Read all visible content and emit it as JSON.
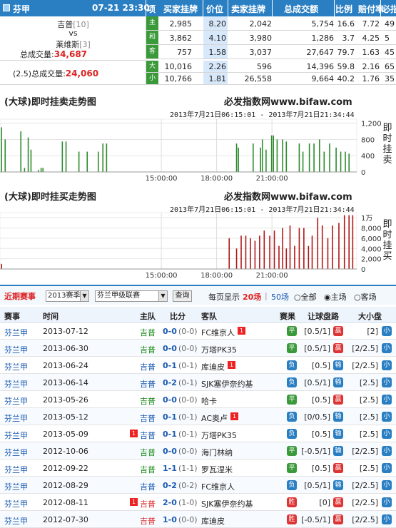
{
  "header": {
    "league": "芬甲",
    "datetime": "07-21 23:30",
    "cols": [
      "项",
      "买家挂牌",
      "价位",
      "卖家挂牌",
      "总成交额",
      "比例",
      "赔付率",
      "必指"
    ]
  },
  "match": {
    "home": "吉普",
    "home_rank": "[10]",
    "vs": "vs",
    "away": "莱维斯",
    "away_rank": "[3]",
    "total_label": "总成交量:",
    "total": "34,687",
    "ou_label": "(2.5)总成交量:",
    "ou_total": "24,060"
  },
  "market_rows": [
    {
      "label": "主",
      "buy": "2,985",
      "price": "8.20",
      "sell": "2,042",
      "total": "5,754",
      "ratio": "16.6",
      "payout": "7.72",
      "idx": "49"
    },
    {
      "label": "和",
      "buy": "3,862",
      "price": "4.10",
      "sell": "3,980",
      "total": "1,286",
      "ratio": "3.7",
      "payout": "4.25",
      "idx": "5"
    },
    {
      "label": "客",
      "buy": "757",
      "price": "1.58",
      "sell": "3,037",
      "total": "27,647",
      "ratio": "79.7",
      "payout": "1.63",
      "idx": "45"
    },
    {
      "label": "大",
      "buy": "10,016",
      "price": "2.26",
      "sell": "596",
      "total": "14,396",
      "ratio": "59.8",
      "payout": "2.16",
      "idx": "65"
    },
    {
      "label": "小",
      "buy": "10,766",
      "price": "1.81",
      "sell": "26,558",
      "total": "9,664",
      "ratio": "40.2",
      "payout": "1.76",
      "idx": "35"
    }
  ],
  "chart1": {
    "title": "(大球)即时挂卖走势图",
    "site": "必发指数网www.bifaw.com",
    "range": "2013年7月21日06:15:01 - 2013年7月21日21:34:44",
    "side_label": "即时挂卖",
    "yticks": [
      "1,200",
      "800",
      "400",
      "0"
    ],
    "xticks": [
      "15:00:00",
      "18:00:00",
      "21:00:00"
    ]
  },
  "chart2": {
    "title": "(大球)即时挂买走势图",
    "site": "必发指数网www.bifaw.com",
    "range": "2013年7月21日06:15:01 - 2013年7月21日21:34:44",
    "side_label": "即时挂买",
    "yticks": [
      "1万",
      "8,000",
      "6,000",
      "4,000",
      "2,000",
      "0"
    ],
    "xticks": [
      "15:00:00",
      "18:00:00",
      "21:00:00"
    ]
  },
  "chart_data": [
    {
      "type": "bar",
      "title": "(大球)即时挂卖走势图",
      "ylim": [
        0,
        1300
      ],
      "x_range": [
        "06:15:01",
        "21:34:44"
      ],
      "values": [
        [
          6.3,
          1100
        ],
        [
          6.5,
          800
        ],
        [
          7.35,
          1000
        ],
        [
          7.55,
          100
        ],
        [
          7.75,
          850
        ],
        [
          7.9,
          550
        ],
        [
          8.3,
          50
        ],
        [
          8.45,
          100
        ],
        [
          8.55,
          100
        ],
        [
          9.6,
          750
        ],
        [
          9.8,
          750
        ],
        [
          10.5,
          500
        ],
        [
          10.95,
          500
        ],
        [
          11.55,
          500
        ],
        [
          11.8,
          700
        ],
        [
          12.0,
          700
        ],
        [
          19.05,
          700
        ],
        [
          19.15,
          600
        ],
        [
          19.95,
          700
        ],
        [
          20.35,
          600
        ],
        [
          20.45,
          800
        ],
        [
          20.65,
          550
        ],
        [
          20.95,
          900
        ],
        [
          21.05,
          900
        ],
        [
          21.25,
          800
        ],
        [
          21.55,
          800
        ],
        [
          21.75,
          750
        ],
        [
          22.45,
          700
        ],
        [
          22.65,
          500
        ],
        [
          23.0,
          700
        ],
        [
          23.25,
          700
        ],
        [
          23.55,
          800
        ],
        [
          23.8,
          500
        ],
        [
          24.1,
          700
        ],
        [
          24.45,
          600
        ],
        [
          24.7,
          500
        ],
        [
          24.95,
          500
        ],
        [
          25.15,
          450
        ]
      ]
    },
    {
      "type": "bar",
      "title": "(大球)即时挂买走势图",
      "ylim": [
        0,
        11000
      ],
      "x_range": [
        "06:15:01",
        "21:34:44"
      ],
      "values": [
        [
          6.3,
          1000
        ],
        [
          18.65,
          6000
        ],
        [
          19.05,
          4000
        ],
        [
          19.3,
          6500
        ],
        [
          19.55,
          6500
        ],
        [
          19.8,
          6000
        ],
        [
          20.05,
          5500
        ],
        [
          20.3,
          6500
        ],
        [
          20.55,
          7500
        ],
        [
          20.85,
          6500
        ],
        [
          21.1,
          7500
        ],
        [
          21.35,
          4500
        ],
        [
          21.55,
          8000
        ],
        [
          21.75,
          4000
        ],
        [
          21.95,
          8500
        ],
        [
          22.2,
          4500
        ],
        [
          22.45,
          8000
        ],
        [
          22.7,
          8000
        ],
        [
          22.95,
          4500
        ],
        [
          23.15,
          6500
        ],
        [
          23.45,
          10000
        ],
        [
          23.7,
          8500
        ],
        [
          24.0,
          6000
        ],
        [
          24.25,
          8500
        ],
        [
          24.6,
          9000
        ],
        [
          24.9,
          10500
        ],
        [
          25.15,
          10500
        ],
        [
          25.35,
          10500
        ]
      ]
    }
  ],
  "filter": {
    "label": "近期赛事",
    "season": "2013赛季",
    "league": "芬兰甲级联赛",
    "query": "查询",
    "per_page_label": "每页显示",
    "per_page": "20场",
    "opt_50": "50场",
    "opt_all": "全部",
    "opt_home": "主场",
    "opt_away": "客场"
  },
  "table_headers": [
    "赛事",
    "时间",
    "主队",
    "比分",
    "客队",
    "赛果",
    "让球盘路",
    "大小盘"
  ],
  "matches": [
    {
      "league": "芬兰甲",
      "date": "2013-07-12",
      "home": "吉普",
      "score": "0-0",
      "ht": "(0-0)",
      "away": "FC维京人",
      "away_card": "1",
      "result": "平",
      "result_color": "#3a9a3a",
      "hcp": "[0.5/1]",
      "hcp_res": "赢",
      "hcp_color": "#d33",
      "ou": "[2]",
      "ou_res": "小",
      "ou_color": "#2a7fc3",
      "home_color": "#1a8a1a"
    },
    {
      "league": "芬兰甲",
      "date": "2013-06-30",
      "home": "吉普",
      "score": "0-0",
      "ht": "(0-0)",
      "away": "万塔PK35",
      "result": "平",
      "result_color": "#3a9a3a",
      "hcp": "[0.5/1]",
      "hcp_res": "赢",
      "hcp_color": "#d33",
      "ou": "[2/2.5]",
      "ou_res": "小",
      "ou_color": "#2a7fc3",
      "home_color": "#1a8a1a"
    },
    {
      "league": "芬兰甲",
      "date": "2013-06-24",
      "home": "吉普",
      "score": "0-1",
      "ht": "(0-1)",
      "away": "库迪皮",
      "away_card": "1",
      "result": "负",
      "result_color": "#2a7fc3",
      "hcp": "[0.5]",
      "hcp_res": "输",
      "hcp_color": "#2a7fc3",
      "ou": "[2/2.5]",
      "ou_res": "小",
      "ou_color": "#2a7fc3",
      "home_color": "#1a5ab0"
    },
    {
      "league": "芬兰甲",
      "date": "2013-06-14",
      "home": "吉普",
      "score": "0-2",
      "ht": "(0-1)",
      "away": "SJK塞伊奈约基",
      "result": "负",
      "result_color": "#2a7fc3",
      "hcp": "[0.5/1]",
      "hcp_res": "输",
      "hcp_color": "#2a7fc3",
      "ou": "[2.5]",
      "ou_res": "小",
      "ou_color": "#2a7fc3",
      "home_color": "#1a5ab0"
    },
    {
      "league": "芬兰甲",
      "date": "2013-05-26",
      "home": "吉普",
      "score": "0-0",
      "ht": "(0-0)",
      "away": "哈卡",
      "result": "平",
      "result_color": "#3a9a3a",
      "hcp": "[0.5]",
      "hcp_res": "赢",
      "hcp_color": "#d33",
      "ou": "[2.5]",
      "ou_res": "小",
      "ou_color": "#2a7fc3",
      "home_color": "#1a8a1a"
    },
    {
      "league": "芬兰甲",
      "date": "2013-05-12",
      "home": "吉普",
      "score": "0-1",
      "ht": "(0-1)",
      "away": "AC奥卢",
      "away_card": "1",
      "result": "负",
      "result_color": "#2a7fc3",
      "hcp": "[0/0.5]",
      "hcp_res": "输",
      "hcp_color": "#2a7fc3",
      "ou": "[2.5]",
      "ou_res": "小",
      "ou_color": "#2a7fc3",
      "home_color": "#1a5ab0"
    },
    {
      "league": "芬兰甲",
      "date": "2013-05-09",
      "home": "吉普",
      "home_card": "1",
      "score": "0-1",
      "ht": "(0-1)",
      "away": "万塔PK35",
      "result": "负",
      "result_color": "#2a7fc3",
      "hcp": "[0.5]",
      "hcp_res": "输",
      "hcp_color": "#2a7fc3",
      "ou": "[2.5]",
      "ou_res": "小",
      "ou_color": "#2a7fc3",
      "home_color": "#1a5ab0"
    },
    {
      "league": "芬兰甲",
      "date": "2012-10-06",
      "home": "吉普",
      "score": "0-0",
      "ht": "(0-0)",
      "away": "海门林纳",
      "result": "平",
      "result_color": "#3a9a3a",
      "hcp": "[-0.5/1]",
      "hcp_res": "输",
      "hcp_color": "#2a7fc3",
      "ou": "[2/2.5]",
      "ou_res": "小",
      "ou_color": "#2a7fc3",
      "home_color": "#1a8a1a"
    },
    {
      "league": "芬兰甲",
      "date": "2012-09-22",
      "home": "吉普",
      "score": "1-1",
      "ht": "(1-1)",
      "away": "罗瓦涅米",
      "result": "平",
      "result_color": "#3a9a3a",
      "hcp": "[0.5]",
      "hcp_res": "赢",
      "hcp_color": "#d33",
      "ou": "[2.5]",
      "ou_res": "小",
      "ou_color": "#2a7fc3",
      "home_color": "#1a8a1a"
    },
    {
      "league": "芬兰甲",
      "date": "2012-08-29",
      "home": "吉普",
      "score": "0-2",
      "ht": "(0-2)",
      "away": "FC维京人",
      "result": "负",
      "result_color": "#2a7fc3",
      "hcp": "[0.5/1]",
      "hcp_res": "输",
      "hcp_color": "#2a7fc3",
      "ou": "[2/2.5]",
      "ou_res": "小",
      "ou_color": "#2a7fc3",
      "home_color": "#1a5ab0"
    },
    {
      "league": "芬兰甲",
      "date": "2012-08-11",
      "home": "吉普",
      "home_card": "1",
      "score": "2-0",
      "ht": "(1-0)",
      "away": "SJK塞伊奈约基",
      "result": "胜",
      "result_color": "#d33",
      "hcp": "[0]",
      "hcp_res": "赢",
      "hcp_color": "#d33",
      "ou": "[2/2.5]",
      "ou_res": "小",
      "ou_color": "#2a7fc3",
      "home_color": "#d33"
    },
    {
      "league": "芬兰甲",
      "date": "2012-07-30",
      "home": "吉普",
      "score": "1-0",
      "ht": "(0-0)",
      "away": "库迪皮",
      "result": "胜",
      "result_color": "#d33",
      "hcp": "[-0.5/1]",
      "hcp_res": "赢",
      "hcp_color": "#d33",
      "ou": "[2/2.5]",
      "ou_res": "小",
      "ou_color": "#2a7fc3",
      "home_color": "#d33"
    }
  ],
  "colors": {
    "accent": "#2a7fc3",
    "green_bar": "#2e8b2e",
    "red_bar": "#b01818"
  }
}
